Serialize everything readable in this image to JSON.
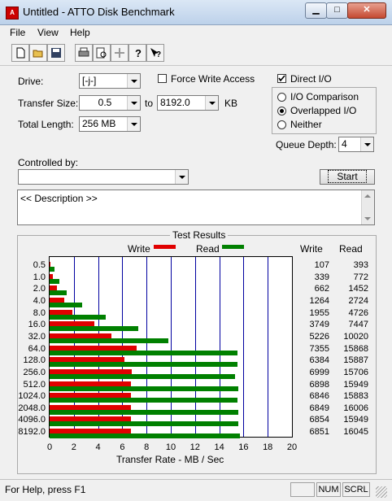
{
  "window": {
    "title": "Untitled - ATTO Disk Benchmark"
  },
  "menu": [
    "File",
    "View",
    "Help"
  ],
  "toolbar": {
    "icons": [
      "new-icon",
      "open-icon",
      "save-icon",
      "print-icon",
      "print-preview-icon",
      "move-icon",
      "help-icon",
      "context-help-icon"
    ]
  },
  "form": {
    "drive_label": "Drive:",
    "drive_value": "[-j-]",
    "force_write_label": "Force Write Access",
    "force_write_checked": false,
    "direct_io_label": "Direct I/O",
    "direct_io_checked": true,
    "transfer_size_label": "Transfer Size:",
    "transfer_from": "0.5",
    "to_label": "to",
    "transfer_to": "8192.0",
    "kb_label": "KB",
    "total_length_label": "Total Length:",
    "total_length_value": "256 MB",
    "io_options": [
      {
        "label": "I/O Comparison",
        "selected": false
      },
      {
        "label": "Overlapped I/O",
        "selected": true
      },
      {
        "label": "Neither",
        "selected": false
      }
    ],
    "queue_depth_label": "Queue Depth:",
    "queue_depth_value": "4",
    "controlled_by_label": "Controlled by:",
    "controlled_by_value": "",
    "start_label": "Start",
    "description_text": "<< Description >>"
  },
  "results": {
    "group_title": "Test Results",
    "write_legend": "Write",
    "read_legend": "Read",
    "write_header": "Write",
    "read_header": "Read",
    "xlabel": "Transfer Rate - MB / Sec"
  },
  "chart_data": {
    "type": "bar",
    "orientation": "horizontal",
    "title": "Test Results",
    "xlabel": "Transfer Rate - MB / Sec",
    "xlim": [
      0,
      20
    ],
    "xticks": [
      "0",
      "2",
      "4",
      "6",
      "8",
      "10",
      "12",
      "14",
      "16",
      "18",
      "20"
    ],
    "grid": true,
    "legend": "top",
    "categories": [
      "0.5",
      "1.0",
      "2.0",
      "4.0",
      "8.0",
      "16.0",
      "32.0",
      "64.0",
      "128.0",
      "256.0",
      "512.0",
      "1024.0",
      "2048.0",
      "4096.0",
      "8192.0"
    ],
    "series": [
      {
        "name": "Write",
        "color": "#e00000",
        "values": [
          0.1,
          0.3,
          0.6,
          1.2,
          1.9,
          3.7,
          5.1,
          7.2,
          6.2,
          6.8,
          6.7,
          6.7,
          6.7,
          6.7,
          6.7
        ]
      },
      {
        "name": "Read",
        "color": "#008000",
        "values": [
          0.4,
          0.8,
          1.4,
          2.7,
          4.6,
          7.3,
          9.8,
          15.5,
          15.5,
          15.3,
          15.6,
          15.5,
          15.6,
          15.6,
          15.7
        ]
      }
    ],
    "write_numbers": [
      "107",
      "339",
      "662",
      "1264",
      "1955",
      "3749",
      "5226",
      "7355",
      "6384",
      "6999",
      "6898",
      "6846",
      "6849",
      "6854",
      "6851"
    ],
    "read_numbers": [
      "393",
      "772",
      "1452",
      "2724",
      "4726",
      "7447",
      "10020",
      "15868",
      "15887",
      "15706",
      "15949",
      "15883",
      "16006",
      "15949",
      "16045"
    ]
  },
  "status": {
    "text": "For Help, press F1",
    "panels": [
      "NUM",
      "SCRL"
    ]
  }
}
